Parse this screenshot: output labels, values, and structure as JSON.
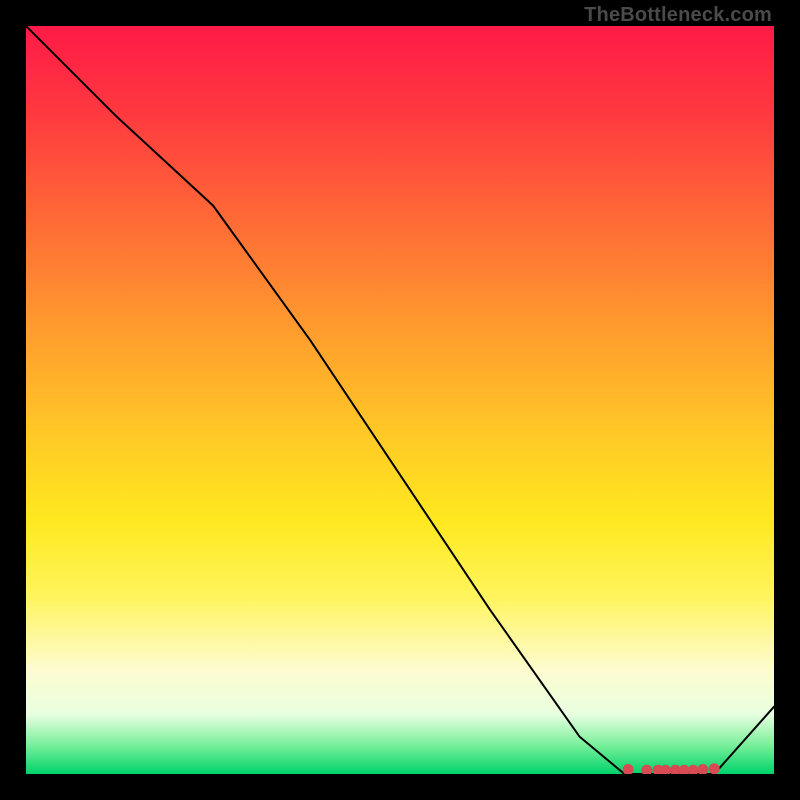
{
  "watermark": "TheBottleneck.com",
  "chart_data": {
    "type": "line",
    "title": "",
    "xlabel": "",
    "ylabel": "",
    "xlim": [
      0,
      100
    ],
    "ylim": [
      0,
      100
    ],
    "grid": false,
    "legend": false,
    "annotations": [],
    "series": [
      {
        "name": "curve",
        "x": [
          0,
          12,
          25,
          38,
          50,
          62,
          74,
          80,
          84,
          88,
          92,
          100
        ],
        "y": [
          100,
          88,
          76,
          58,
          40,
          22,
          5,
          0,
          0,
          0,
          0,
          9
        ]
      }
    ],
    "markers": {
      "name": "bottom-cluster",
      "x": [
        80.5,
        83,
        84.5,
        85.5,
        86.8,
        88,
        89.2,
        90.5,
        92
      ],
      "y": [
        0.6,
        0.5,
        0.5,
        0.5,
        0.5,
        0.5,
        0.5,
        0.6,
        0.7
      ],
      "color": "#d84b52",
      "size": 5
    }
  }
}
